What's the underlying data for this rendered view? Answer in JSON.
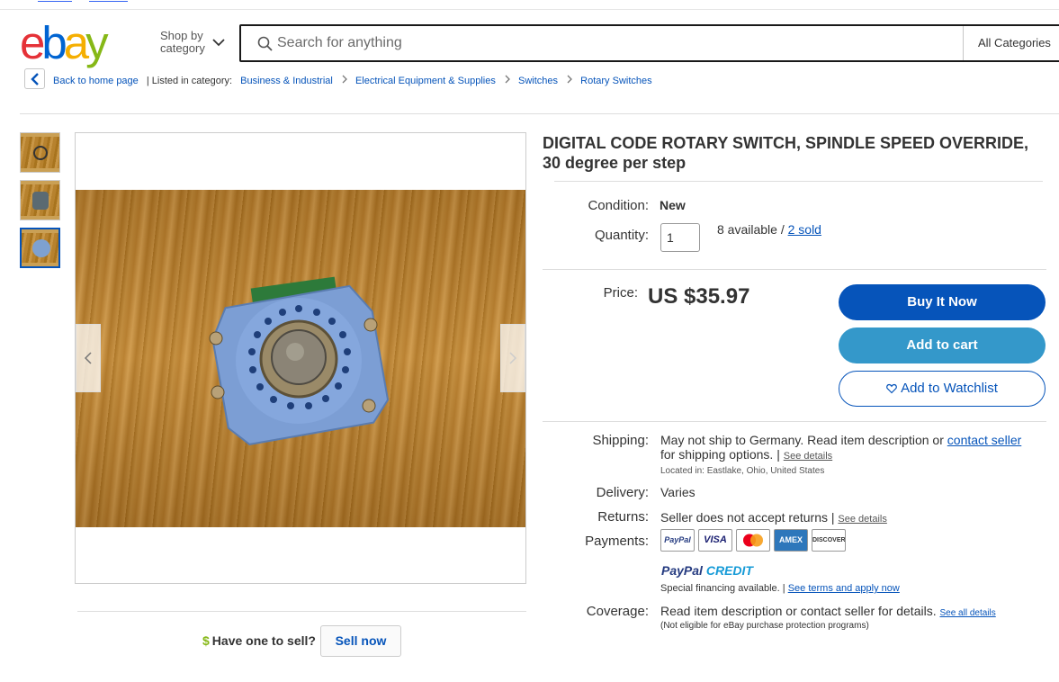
{
  "header": {
    "logo": [
      "e",
      "b",
      "a",
      "y"
    ],
    "shop_by": "Shop by",
    "category": "category",
    "search_placeholder": "Search for anything",
    "category_select": "All Categories"
  },
  "breadcrumb": {
    "back": "Back to home page",
    "listed_in": "| Listed in category:",
    "items": [
      "Business & Industrial",
      "Electrical Equipment & Supplies",
      "Switches",
      "Rotary Switches"
    ]
  },
  "item": {
    "title": "DIGITAL CODE ROTARY SWITCH, SPINDLE SPEED OVERRIDE, 30 degree per step",
    "condition_label": "Condition:",
    "condition": "New",
    "quantity_label": "Quantity:",
    "quantity_value": "1",
    "available": "8 available /",
    "sold": "2 sold",
    "price_label": "Price:",
    "price": "US $35.97",
    "buy_now": "Buy It Now",
    "add_cart": "Add to cart",
    "watchlist": "Add to Watchlist"
  },
  "shipping": {
    "label": "Shipping:",
    "text1": "May not ship to Germany. Read item description or",
    "contact": "contact seller",
    "text2": "for shipping options. |",
    "see_details": "See details",
    "located": "Located in: Eastlake, Ohio, United States"
  },
  "delivery": {
    "label": "Delivery:",
    "value": "Varies"
  },
  "returns": {
    "label": "Returns:",
    "value": "Seller does not accept returns |",
    "see_details": "See details"
  },
  "payments": {
    "label": "Payments:",
    "methods": [
      "PayPal",
      "VISA",
      "",
      "AMEX",
      "DISCOVER"
    ],
    "credit_1": "PayPal",
    "credit_2": "CREDIT",
    "financing": "Special financing available. |",
    "terms": "See terms and apply now"
  },
  "coverage": {
    "label": "Coverage:",
    "value": "Read item description or contact seller for details.",
    "see_all": "See all details",
    "note": "(Not eligible for eBay purchase protection programs)"
  },
  "sell": {
    "prompt": "Have one to sell?",
    "button": "Sell now",
    "symbol": "$"
  },
  "colors": {
    "primary": "#0654ba",
    "cart": "#3498ca"
  }
}
